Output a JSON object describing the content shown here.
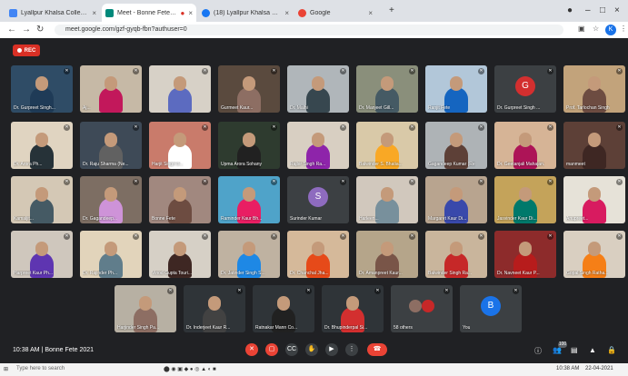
{
  "browser": {
    "tabs": [
      {
        "label": "Lyallpur Khalsa College - Calen",
        "color": "#4285f4",
        "active": false
      },
      {
        "label": "Meet - Bonne Fete 2021",
        "color": "#00897b",
        "active": true
      },
      {
        "label": "(18) Lyallpur Khalsa College, Jal",
        "color": "#1877f2",
        "active": false
      },
      {
        "label": "Google",
        "color": "#ea4335",
        "active": false
      }
    ],
    "url": "meet.google.com/gzf-gyqb-fbn?authuser=0",
    "profile_initial": "K"
  },
  "recording_badge": "REC",
  "participants": [
    {
      "name": "Dr. Gurpreet Singh...",
      "type": "photo",
      "bg": "#2f4c66",
      "shirt": "#1f3b57"
    },
    {
      "name": "Aj...",
      "type": "photo",
      "bg": "#c6b9a6",
      "shirt": "#c2185b"
    },
    {
      "name": "",
      "type": "photo",
      "bg": "#d7d1c7",
      "shirt": "#5c6bc0"
    },
    {
      "name": "Gurmeet Kaur...",
      "type": "photo",
      "bg": "#5a4a3e",
      "shirt": "#8d6e63"
    },
    {
      "name": "Dr. Malhi",
      "type": "photo",
      "bg": "#b0b6ba",
      "shirt": "#37474f"
    },
    {
      "name": "Dr. Manjeet Gill...",
      "type": "photo",
      "bg": "#8a8f7b",
      "shirt": "#455a64"
    },
    {
      "name": "Ranjit Fete",
      "type": "photo",
      "bg": "#b2c7d9",
      "shirt": "#1565c0"
    },
    {
      "name": "Dr. Gurpreet Singh ...",
      "type": "avatar",
      "bg": "#3c4043",
      "color": "#d32f2f",
      "letter": "G"
    },
    {
      "name": "Prof. Tarlochan Singh",
      "type": "photo",
      "bg": "#c2a37b",
      "shirt": "#6d4c41"
    },
    {
      "name": "Dr. Arora Ph...",
      "type": "photo",
      "bg": "#e0d4c1",
      "shirt": "#263238"
    },
    {
      "name": "Dr. Raju Sharma (Ne...",
      "type": "photo",
      "bg": "#3e4a57",
      "shirt": "#616161"
    },
    {
      "name": "Harjit Singh B...",
      "type": "photo",
      "bg": "#c97b6b",
      "shirt": "#ffffff"
    },
    {
      "name": "Upma Arora Sohany",
      "type": "photo",
      "bg": "#2e3b2f",
      "shirt": "#212121"
    },
    {
      "name": "Rajbir Singh Ra...",
      "type": "photo",
      "bg": "#d8cfc2",
      "shirt": "#8e24aa"
    },
    {
      "name": "Balwinder S. Bhatia...",
      "type": "photo",
      "bg": "#d9c9a8",
      "shirt": "#f9a825"
    },
    {
      "name": "Gagandeep Kumar (Re...",
      "type": "photo",
      "bg": "#aeb3b6",
      "shirt": "#5d4037"
    },
    {
      "name": "Dr. Geetanjali Mahajan...",
      "type": "photo",
      "bg": "#d6b496",
      "shirt": "#ad1457"
    },
    {
      "name": "manmeet",
      "type": "photo",
      "bg": "#5d4037",
      "shirt": "#3e2723"
    },
    {
      "name": "Kamaljit...",
      "type": "photo",
      "bg": "#d4c8b5",
      "shirt": "#455a64"
    },
    {
      "name": "Dr. Gagandeep...",
      "type": "photo",
      "bg": "#7d6e63",
      "shirt": "#ce93d8"
    },
    {
      "name": "Bonne Fete",
      "type": "photo",
      "bg": "#a1887f",
      "shirt": "#6d4c41"
    },
    {
      "name": "Raminder Kaur Bh...",
      "type": "photo",
      "bg": "#4fa3c9",
      "shirt": "#e91e63"
    },
    {
      "name": "Surinder Kumar",
      "type": "avatar",
      "bg": "#3c4043",
      "color": "#8e6bbf",
      "letter": "S"
    },
    {
      "name": "Harleen...",
      "type": "photo",
      "bg": "#d1c8bd",
      "shirt": "#78909c"
    },
    {
      "name": "Margaret Kaur Di...",
      "type": "photo",
      "bg": "#b8a48f",
      "shirt": "#3949ab"
    },
    {
      "name": "Jasvinder Kaur Di...",
      "type": "photo",
      "bg": "#c4a35a",
      "shirt": "#00796b"
    },
    {
      "name": "Anupreet...",
      "type": "photo",
      "bg": "#e6e2d8",
      "shirt": "#d81b60"
    },
    {
      "name": "Harpreet Kaur Ph...",
      "type": "photo",
      "bg": "#cfc7bd",
      "shirt": "#5e35b1"
    },
    {
      "name": "Dr. Rajinder Ph...",
      "type": "photo",
      "bg": "#e2d4bb",
      "shirt": "#607d8b"
    },
    {
      "name": "Vinod Gupta Touri...",
      "type": "photo",
      "bg": "#d6d0c6",
      "shirt": "#3e2723"
    },
    {
      "name": "Dr. Jatinder Singh S...",
      "type": "photo",
      "bg": "#bfb2a1",
      "shirt": "#1e88e5"
    },
    {
      "name": "Dr. Chanchal Jha...",
      "type": "photo",
      "bg": "#d5b99a",
      "shirt": "#e64a19"
    },
    {
      "name": "Dr. Amanpreet Kaur...",
      "type": "photo",
      "bg": "#b5a58a",
      "shirt": "#795548"
    },
    {
      "name": "Balwinder Singh Ra...",
      "type": "photo",
      "bg": "#c9b59c",
      "shirt": "#c62828"
    },
    {
      "name": "Dr. Navneet Kaur P...",
      "type": "photo",
      "bg": "#8d2b2b",
      "shirt": "#b71c1c"
    },
    {
      "name": "Gopal Singh Ratha...",
      "type": "photo",
      "bg": "#d9cfc1",
      "shirt": "#f57f17"
    },
    {
      "name": "Harjinder Singh Pa...",
      "type": "photo",
      "bg": "#b7b0a3",
      "shirt": "#8d6e63"
    },
    {
      "name": "Dr. Inderjeet Kaur R...",
      "type": "photo",
      "bg": "#2f3438",
      "shirt": "#424242"
    },
    {
      "name": "Ratnakar Mann Co...",
      "type": "photo",
      "bg": "#2f3438",
      "shirt": "#212121"
    },
    {
      "name": "Dr. Bhupinderpal Si...",
      "type": "photo",
      "bg": "#2f3438",
      "shirt": "#d32f2f"
    },
    {
      "name": "58 others",
      "type": "group",
      "bg": "#3c4043",
      "shirt": "#3c4043"
    },
    {
      "name": "You",
      "type": "avatar",
      "bg": "#3c4043",
      "color": "#1a73e8",
      "letter": "B"
    }
  ],
  "bottom_bar": {
    "time": "10:38 AM",
    "separator": "|",
    "meeting_name": "Bonne Fete 2021",
    "participant_count": "100"
  },
  "taskbar": {
    "search_placeholder": "Type here to search",
    "time": "10:38 AM",
    "date": "22-04-2021"
  },
  "colors": {
    "meet_bg": "#202124",
    "tile_bg": "#3c4043",
    "end_call": "#ea4335"
  }
}
